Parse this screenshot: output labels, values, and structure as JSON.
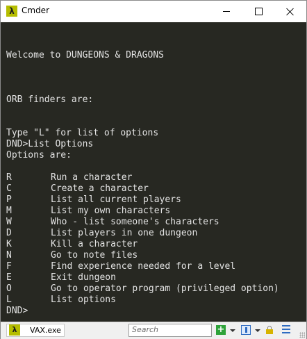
{
  "window": {
    "title": "Cmder",
    "icon": "lambda-icon",
    "app_glyph": "λ"
  },
  "console": {
    "welcome": "Welcome to DUNGEONS & DRAGONS",
    "orb_line": "ORB finders are:",
    "hint": "Type \"L\" for list of options",
    "command": "DND>List Options",
    "options_header": "Options are:",
    "options": [
      {
        "key": "R",
        "desc": "Run a character"
      },
      {
        "key": "C",
        "desc": "Create a character"
      },
      {
        "key": "P",
        "desc": "List all current players"
      },
      {
        "key": "M",
        "desc": "List my own characters"
      },
      {
        "key": "W",
        "desc": "Who - list someone's characters"
      },
      {
        "key": "D",
        "desc": "List players in one dungeon"
      },
      {
        "key": "K",
        "desc": "Kill a character"
      },
      {
        "key": "N",
        "desc": "Go to note files"
      },
      {
        "key": "F",
        "desc": "Find experience needed for a level"
      },
      {
        "key": "E",
        "desc": "Exit dungeon"
      },
      {
        "key": "O",
        "desc": "Go to operator program (privileged option)"
      },
      {
        "key": "L",
        "desc": "List options"
      }
    ],
    "prompt": "DND>"
  },
  "statusbar": {
    "tab_label": "VAX.exe",
    "search_placeholder": "Search",
    "plus_glyph": "+"
  },
  "colors": {
    "console_bg": "#272822",
    "console_text": "#e3e3e3",
    "accent": "#b5bd00"
  }
}
